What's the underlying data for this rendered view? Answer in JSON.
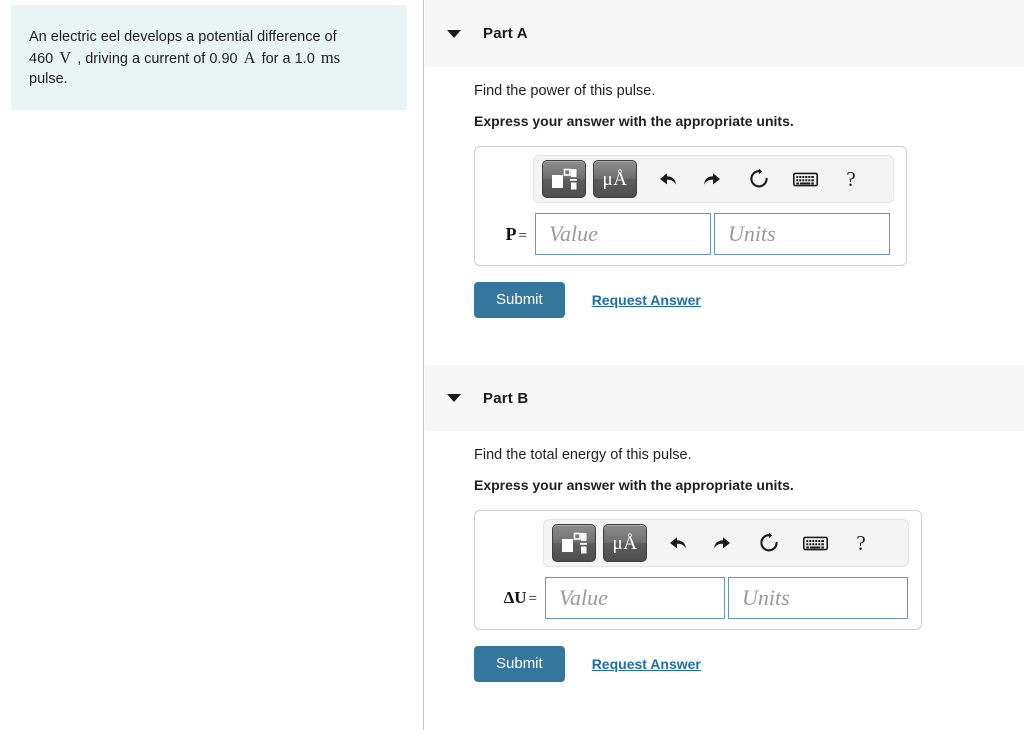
{
  "problem": {
    "text_before_v": "An electric eel develops a potential difference of 460",
    "unit_volt": "V",
    "text_mid": ", driving a current of 0.90",
    "unit_amp": "A",
    "text_after": "for a 1.0 ms pulse.",
    "line1": "An electric eel develops a potential difference of",
    "line2_num": "460",
    "line2_mid": ", driving a current of 0.90",
    "line2_tail": "for a 1.0",
    "unit_ms": "ms",
    "line3": "pulse."
  },
  "toolbar": {
    "template_icon": "math-template-icon",
    "units_label": "μÅ",
    "undo_icon": "undo-arrow-icon",
    "redo_icon": "redo-arrow-icon",
    "reset_icon": "reset-circle-icon",
    "keyboard_icon": "keyboard-icon",
    "help_label": "?"
  },
  "fields": {
    "value_placeholder": "Value",
    "units_placeholder": "Units",
    "value_current": "",
    "units_current": ""
  },
  "actions": {
    "submit_label": "Submit",
    "request_label": "Request Answer"
  },
  "colors": {
    "submit_blue": "#34769c",
    "link_blue": "#1b6ea8",
    "field_border": "#6a96b5",
    "problem_bg": "#e9f4f4",
    "header_bg": "#f7f7f7"
  },
  "parts": [
    {
      "id": "A",
      "title": "Part A",
      "prompt": "Find the power of this pulse.",
      "instruction": "Express your answer with the appropriate units.",
      "variable": "P",
      "equals": "="
    },
    {
      "id": "B",
      "title": "Part B",
      "prompt": "Find the total energy of this pulse.",
      "instruction": "Express your answer with the appropriate units.",
      "variable": "ΔU",
      "equals": "="
    }
  ]
}
